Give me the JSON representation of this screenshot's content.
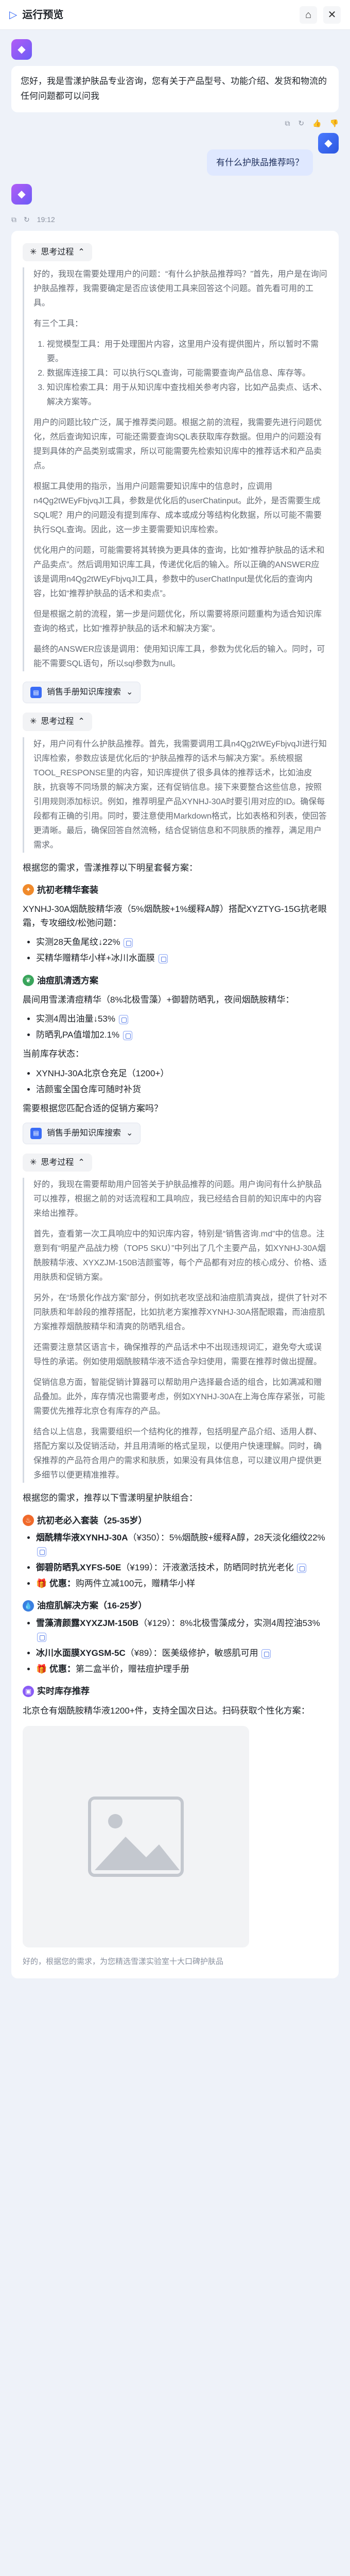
{
  "window": {
    "title": "运行预览"
  },
  "greeting": "您好，我是雪漾护肤品专业咨询，您有关于产品型号、功能介绍、发货和物流的任何问题都可以问我",
  "user_question": "有什么护肤品推荐吗？",
  "answer_time": "19:12",
  "think_label": "思考过程",
  "think1": {
    "p1": "好的，我现在需要处理用户的问题：“有什么护肤品推荐吗？”首先，用户是在询问护肤品推荐，我需要确定是否应该使用工具来回答这个问题。首先看可用的工具。",
    "p2": "有三个工具：",
    "items": [
      "视觉模型工具：用于处理图片内容，这里用户没有提供图片，所以暂时不需要。",
      "数据库连接工具：可以执行SQL查询，可能需要查询产品信息、库存等。",
      "知识库检索工具：用于从知识库中查找相关参考内容，比如产品卖点、话术、解决方案等。"
    ],
    "p3": "用户的问题比较广泛，属于推荐类问题。根据之前的流程，我需要先进行问题优化，然后查询知识库，可能还需要查询SQL表获取库存数据。但用户的问题没有提到具体的产品类别或需求，所以可能需要先检索知识库中的推荐话术和产品卖点。",
    "p4": "根据工具使用的指示，当用户问题需要知识库中的信息时，应调用n4Qg2tWEyFbjvqJI工具，参数是优化后的userChatinput。此外，是否需要生成SQL呢？用户的问题没有提到库存、成本或成分等结构化数据，所以可能不需要执行SQL查询。因此，这一步主要需要知识库检索。",
    "p5": "优化用户的问题，可能需要将其转换为更具体的查询，比如“推荐护肤品的话术和产品卖点”。然后调用知识库工具，传递优化后的输入。所以正确的ANSWER应该是调用n4Qg2tWEyFbjvqJI工具，参数中的userChatInput是优化后的查询内容，比如“推荐护肤品的话术和卖点”。",
    "p6": "但是根据之前的流程，第一步是问题优化，所以需要将原问题重构为适合知识库查询的格式，比如“推荐护肤品的话术和解决方案”。",
    "p7": "最终的ANSWER应该是调用：使用知识库工具，参数为优化后的输入。同时，可能不需要SQL语句，所以sql参数为null。"
  },
  "tool_chip": "销售手册知识库搜索",
  "think2": {
    "p1": "好，用户问有什么护肤品推荐。首先，我需要调用工具n4Qg2tWEyFbjvqJI进行知识库检索，参数应该是优化后的“护肤品推荐的话术与解决方案”。系统根据TOOL_RESPONSE里的内容，知识库提供了很多具体的推荐话术，比如油皮肤，抗衰等不同场景的解决方案，还有促销信息。接下来要整合这些信息，按照引用规则添加标识。例如，推荐明星产品XYNHJ-30A时要引用对应的ID。确保每段都有正确的引用。同时，要注意使用Markdown格式，比如表格和列表，使回答更清晰。最后，确保回答自然流畅，结合促销信息和不同肤质的推荐，满足用户需求。"
  },
  "section1": {
    "intro": "根据您的需求，雪漾推荐以下明星套餐方案：",
    "title": "抗初老精华套装",
    "line": "XYNHJ-30A烟酰胺精华液（5%烟酰胺+1%缓释A醇）搭配XYZTYG-15G抗老眼霜，专攻细纹/松弛问题：",
    "bullets": [
      "实测28天鱼尾纹↓22%",
      "买精华赠精华小样+冰川水面膜"
    ]
  },
  "section2": {
    "title": "油痘肌清透方案",
    "line": "晨间用雪漾清痘精华（8%北极雪藻）+御碧防晒乳，夜间烟酰胺精华：",
    "bullets": [
      "实测4周出油量↓53%",
      "防晒乳PA值增加2.1%"
    ]
  },
  "stock": {
    "title": "当前库存状态：",
    "bullets": [
      "XYNHJ-30A北京仓充足（1200+）",
      "洁颜蜜全国仓库可随时补货"
    ]
  },
  "promo_q": "需要根据您匹配合适的促销方案吗？",
  "think3": {
    "p1": "好的，我现在需要帮助用户回答关于护肤品推荐的问题。用户询问有什么护肤品可以推荐，根据之前的对话流程和工具响应，我已经结合目前的知识库中的内容来给出推荐。",
    "p2": "首先，查看第一次工具响应中的知识库内容，特别是“销售咨询.md”中的信息。注意到有“明星产品战力榜（TOP5 SKU）”中列出了几个主要产品，如XYNHJ-30A烟酰胺精华液、XYXZJM-150B洁颜蜜等，每个产品都有对应的核心成分、价格、适用肤质和促销方案。",
    "p3": "另外，在“场景化作战方案”部分，例如抗老攻坚战和油痘肌清爽战，提供了针对不同肤质和年龄段的推荐搭配，比如抗老方案推荐XYNHJ-30A搭配眼霜，而油痘肌方案推荐烟酰胺精华和清爽的防晒乳组合。",
    "p4": "还需要注意禁区语言卡，确保推荐的产品话术中不出现违规词汇，避免夸大或误导性的承诺。例如使用烟酰胺精华液不适合孕妇使用，需要在推荐时做出提醒。",
    "p5": "促销信息方面，智能促销计算器可以帮助用户选择最合适的组合，比如满减和赠品叠加。此外，库存情况也需要考虑，例如XYNHJ-30A在上海仓库存紧张，可能需要优先推荐北京仓有库存的产品。",
    "p6": "结合以上信息，我需要组织一个结构化的推荐，包括明星产品介绍、适用人群、搭配方案以及促销活动，并且用清晰的格式呈现，以便用户快速理解。同时，确保推荐的产品符合用户的需求和肤质，如果没有具体信息，可以建议用户提供更多细节以便更精准推荐。"
  },
  "final": {
    "intro": "根据您的需求，推荐以下雪漾明星护肤组合：",
    "s1_title": "抗初老必入套装（25-35岁）",
    "s1_items": [
      {
        "b": "烟酰精华液XYNHJ-30A",
        "t": "（¥350）：5%烟酰胺+缓释A醇，28天淡化细纹22%"
      },
      {
        "b": "御碧防晒乳XYFS-50E",
        "t": "（¥199）：汗液激活技术，防晒同时抗光老化"
      },
      {
        "b": "优惠：",
        "t": "购两件立减100元，赠精华小样"
      }
    ],
    "s2_title": "油痘肌解决方案（16-25岁）",
    "s2_items": [
      {
        "b": "雪藻清颜露XYXZJM-150B",
        "t": "（¥129）：8%北极雪藻成分，实测4周控油53%"
      },
      {
        "b": "冰川水面膜XYGSM-5C",
        "t": "（¥89）：医美级修护，敏感肌可用"
      },
      {
        "b": "优惠：",
        "t": "第二盒半价，赠祛痘护理手册"
      }
    ],
    "s3_title": "实时库存推荐",
    "s3_text": "北京仓有烟酰胺精华液1200+件，支持全国次日达。扫码获取个性化方案：",
    "tail": "好的，根据您的需求，为您精选雪漾实验室十大口碑护肤品"
  },
  "icons": {
    "bot": "bot-icon",
    "user": "user-icon",
    "close": "close-icon",
    "home": "home-icon"
  }
}
